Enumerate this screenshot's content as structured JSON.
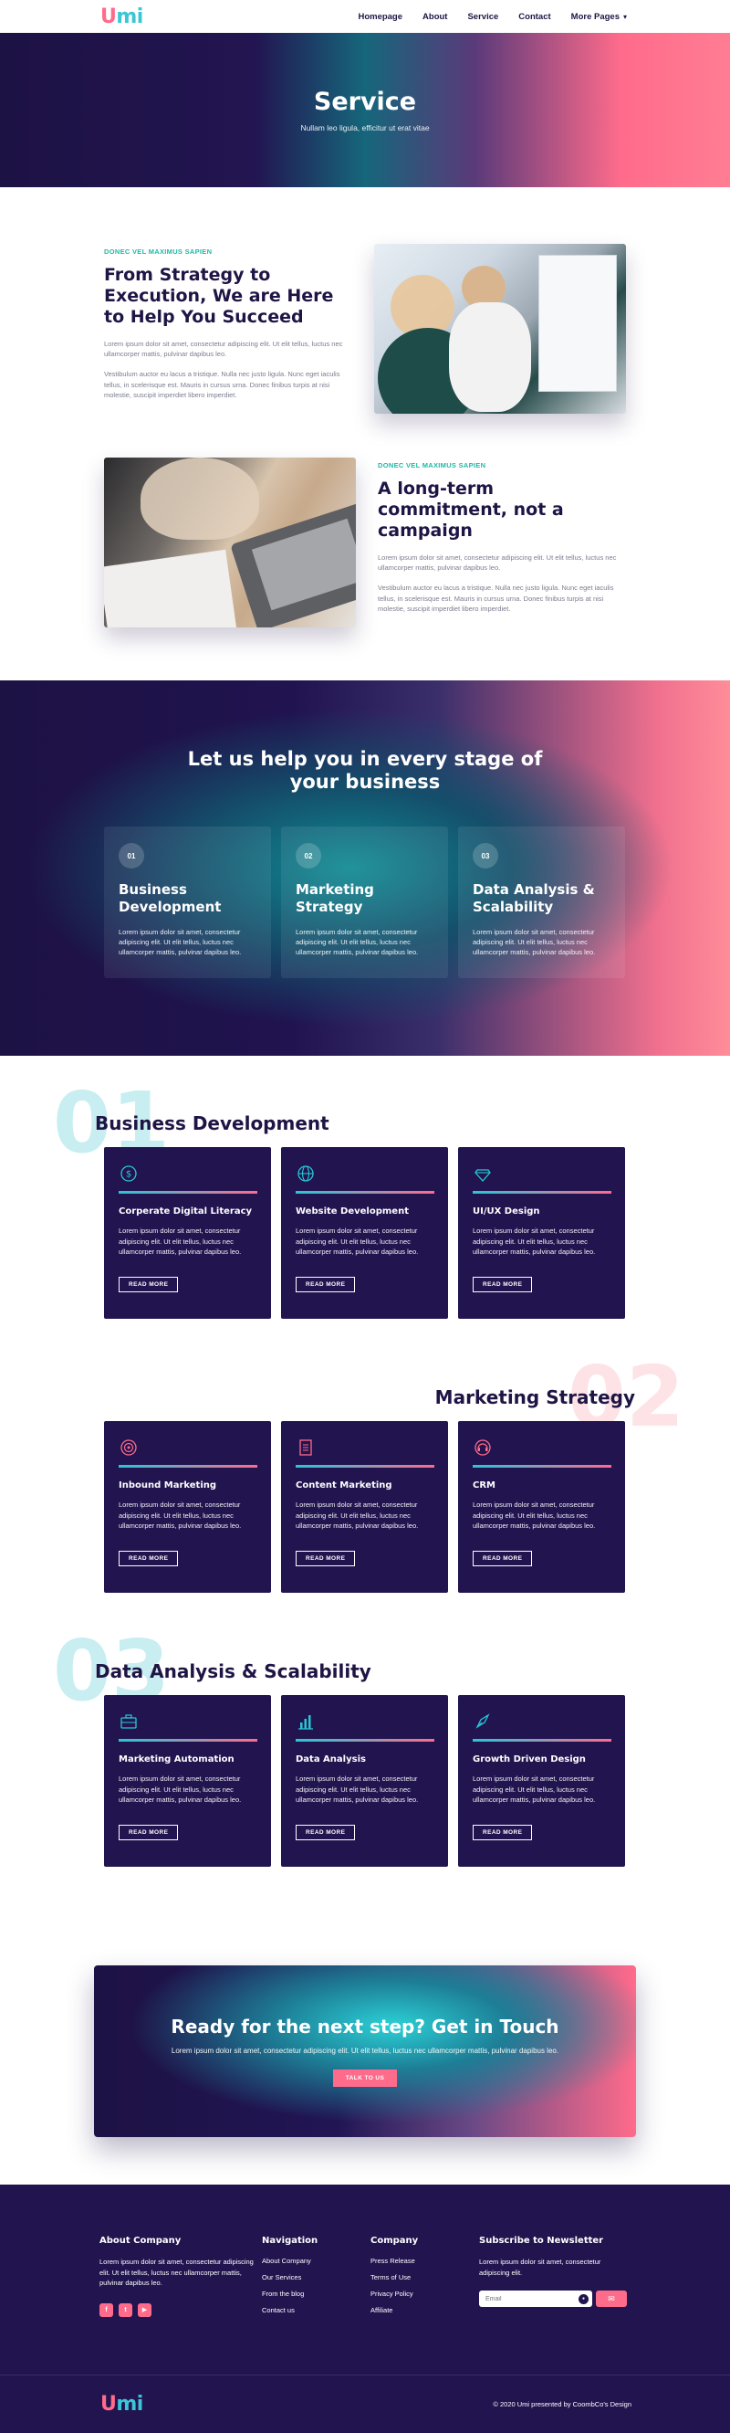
{
  "nav": {
    "logo": [
      "U",
      "mi"
    ],
    "links": [
      "Homepage",
      "About",
      "Service",
      "Contact",
      "More Pages"
    ]
  },
  "hero": {
    "title": "Service",
    "subtitle": "Nullam leo ligula, efficitur ut erat vitae"
  },
  "features": [
    {
      "eyebrow": "DONEC VEL MAXIMUS SAPIEN",
      "title": "From Strategy to Execution, We are Here to Help You Succeed",
      "p1": "Lorem ipsum dolor sit amet, consectetur adipiscing elit. Ut elit tellus, luctus nec ullamcorper mattis, pulvinar dapibus leo.",
      "p2": "Vestibulum auctor eu lacus a tristique. Nulla nec justo ligula. Nunc eget iaculis tellus, in scelerisque est. Mauris in cursus urna. Donec finibus turpis at nisi molestie, suscipit imperdiet libero imperdiet."
    },
    {
      "eyebrow": "DONEC VEL MAXIMUS SAPIEN",
      "title": "A long-term commitment, not a campaign",
      "p1": "Lorem ipsum dolor sit amet, consectetur adipiscing elit. Ut elit tellus, luctus nec ullamcorper mattis, pulvinar dapibus leo.",
      "p2": "Vestibulum auctor eu lacus a tristique. Nulla nec justo ligula. Nunc eget iaculis tellus, in scelerisque est. Mauris in cursus urna. Donec finibus turpis at nisi molestie, suscipit imperdiet libero imperdiet."
    }
  ],
  "stages": {
    "title": "Let us help you in every stage of your business",
    "items": [
      {
        "num": "01",
        "title": "Business Development",
        "text": "Lorem ipsum dolor sit amet, consectetur adipiscing elit. Ut elit tellus, luctus nec ullamcorper mattis, pulvinar dapibus leo."
      },
      {
        "num": "02",
        "title": "Marketing Strategy",
        "text": "Lorem ipsum dolor sit amet, consectetur adipiscing elit. Ut elit tellus, luctus nec ullamcorper mattis, pulvinar dapibus leo."
      },
      {
        "num": "03",
        "title": "Data Analysis & Scalability",
        "text": "Lorem ipsum dolor sit amet, consectetur adipiscing elit. Ut elit tellus, luctus nec ullamcorper mattis, pulvinar dapibus leo."
      }
    ]
  },
  "groups": [
    {
      "num": "01",
      "title": "Business Development",
      "cards": [
        {
          "icon": "money-icon",
          "title": "Corperate Digital Literacy",
          "text": "Lorem ipsum dolor sit amet, consectetur adipiscing elit. Ut elit tellus, luctus nec ullamcorper mattis, pulvinar dapibus leo.",
          "btn": "READ MORE"
        },
        {
          "icon": "globe-icon",
          "title": "Website Development",
          "text": "Lorem ipsum dolor sit amet, consectetur adipiscing elit. Ut elit tellus, luctus nec ullamcorper mattis, pulvinar dapibus leo.",
          "btn": "READ MORE"
        },
        {
          "icon": "diamond-icon",
          "title": "UI/UX Design",
          "text": "Lorem ipsum dolor sit amet, consectetur adipiscing elit. Ut elit tellus, luctus nec ullamcorper mattis, pulvinar dapibus leo.",
          "btn": "READ MORE"
        }
      ]
    },
    {
      "num": "02",
      "title": "Marketing Strategy",
      "cards": [
        {
          "icon": "target-icon",
          "title": "Inbound Marketing",
          "text": "Lorem ipsum dolor sit amet, consectetur adipiscing elit. Ut elit tellus, luctus nec ullamcorper mattis, pulvinar dapibus leo.",
          "btn": "READ MORE"
        },
        {
          "icon": "document-icon",
          "title": "Content Marketing",
          "text": "Lorem ipsum dolor sit amet, consectetur adipiscing elit. Ut elit tellus, luctus nec ullamcorper mattis, pulvinar dapibus leo.",
          "btn": "READ MORE"
        },
        {
          "icon": "support-icon",
          "title": "CRM",
          "text": "Lorem ipsum dolor sit amet, consectetur adipiscing elit. Ut elit tellus, luctus nec ullamcorper mattis, pulvinar dapibus leo.",
          "btn": "READ MORE"
        }
      ]
    },
    {
      "num": "03",
      "title": "Data Analysis & Scalability",
      "cards": [
        {
          "icon": "briefcase-icon",
          "title": "Marketing Automation",
          "text": "Lorem ipsum dolor sit amet, consectetur adipiscing elit. Ut elit tellus, luctus nec ullamcorper mattis, pulvinar dapibus leo.",
          "btn": "READ MORE"
        },
        {
          "icon": "bar-chart-icon",
          "title": "Data Analysis",
          "text": "Lorem ipsum dolor sit amet, consectetur adipiscing elit. Ut elit tellus, luctus nec ullamcorper mattis, pulvinar dapibus leo.",
          "btn": "READ MORE"
        },
        {
          "icon": "pen-tool-icon",
          "title": "Growth Driven Design",
          "text": "Lorem ipsum dolor sit amet, consectetur adipiscing elit. Ut elit tellus, luctus nec ullamcorper mattis, pulvinar dapibus leo.",
          "btn": "READ MORE"
        }
      ]
    }
  ],
  "cta": {
    "title": "Ready for the next step? Get in Touch",
    "text": "Lorem ipsum dolor sit amet, consectetur adipiscing elit. Ut elit tellus, luctus nec ullamcorper mattis, pulvinar dapibus leo.",
    "btn": "TALK TO US"
  },
  "footer": {
    "about": {
      "title": "About Company",
      "text": "Lorem ipsum dolor sit amet, consectetur adipiscing elit. Ut elit tellus, luctus nec ullamcorper mattis, pulvinar dapibus leo."
    },
    "navigation": {
      "title": "Navigation",
      "links": [
        "About Company",
        "Our Services",
        "From the blog",
        "Contact us"
      ]
    },
    "company": {
      "title": "Company",
      "links": [
        "Press Release",
        "Terms of Use",
        "Privacy Policy",
        "Affiliate"
      ]
    },
    "newsletter": {
      "title": "Subscribe to Newsletter",
      "text": "Lorem ipsum dolor sit amet, consectetur adipiscing elit.",
      "placeholder": "Email"
    },
    "social": [
      "f",
      "t",
      "▶"
    ],
    "copyright": "© 2020 Umi presented by CoombCo's Design"
  },
  "colors": {
    "primary": "#21144f",
    "accent_pink": "#ff6b8b",
    "accent_teal": "#28c7d5"
  }
}
